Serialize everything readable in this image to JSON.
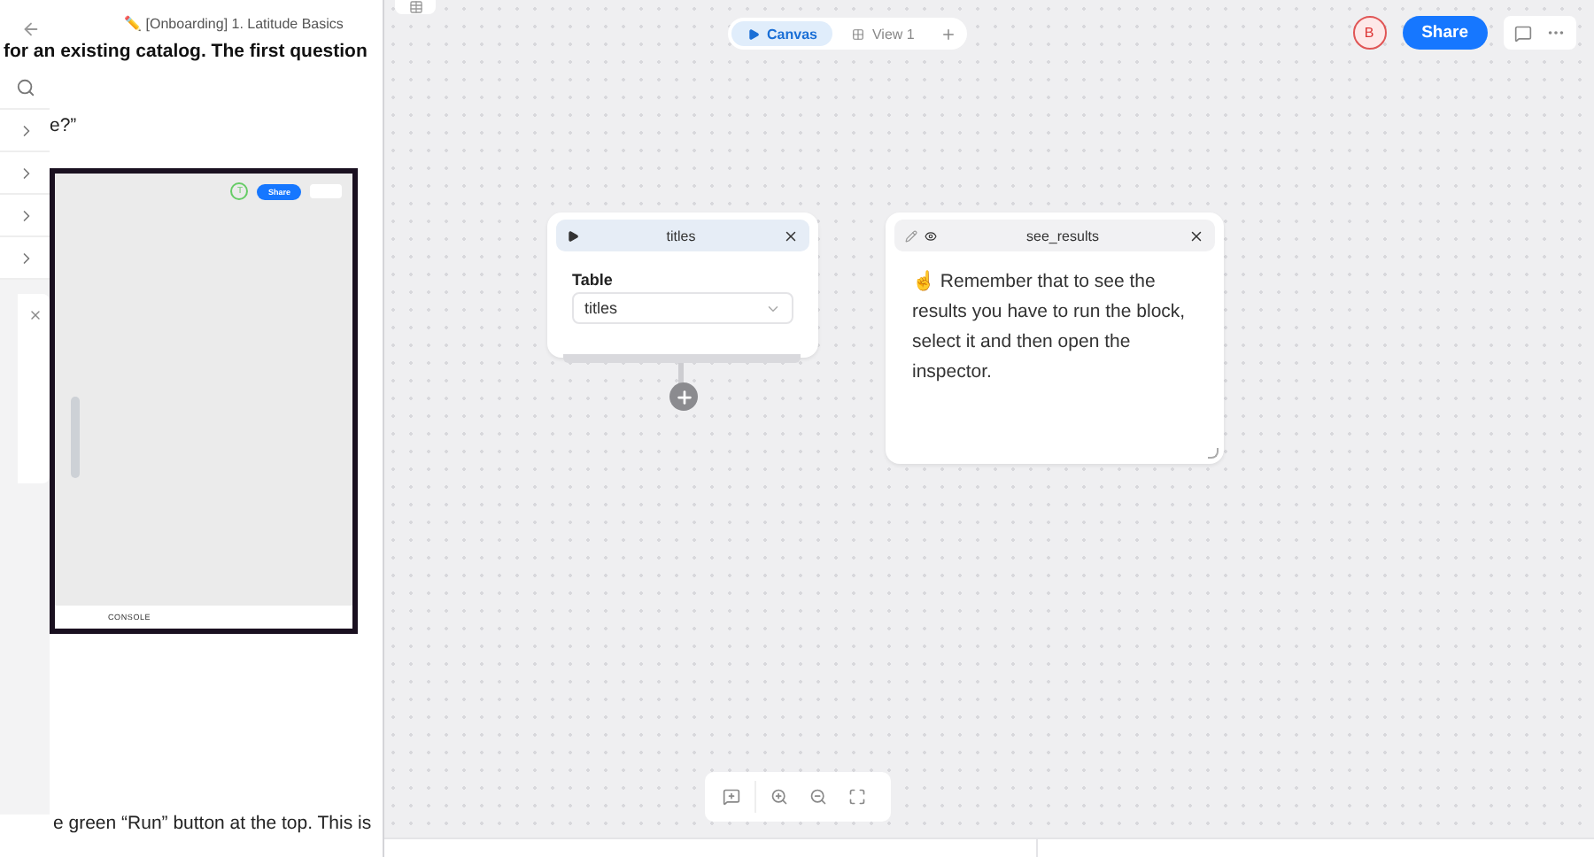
{
  "document": {
    "title": "✏️ [Onboarding] 1. Latitude Basics",
    "paragraphs": [
      {
        "kind": "heading",
        "text": "for an existing catalog. The first question"
      },
      {
        "kind": "body",
        "text": "e?”"
      }
    ],
    "embedded_screenshot": {
      "avatar": "T",
      "share": "Share",
      "console": "CONSOLE"
    },
    "closing_line": "e green “Run” button at the top. This is"
  },
  "view_tabs": [
    {
      "label": "Canvas",
      "selected": true
    },
    {
      "label": "View 1",
      "selected": false
    }
  ],
  "toolbar": {
    "avatar": "B",
    "share": "Share"
  },
  "blocks": [
    {
      "kind": "table",
      "title": "titles",
      "field_label": "Table",
      "value": "titles"
    },
    {
      "kind": "text",
      "title": "see_results",
      "body": "☝ Remember that to see the results you have to run the block, select it and then open the inspector."
    }
  ]
}
